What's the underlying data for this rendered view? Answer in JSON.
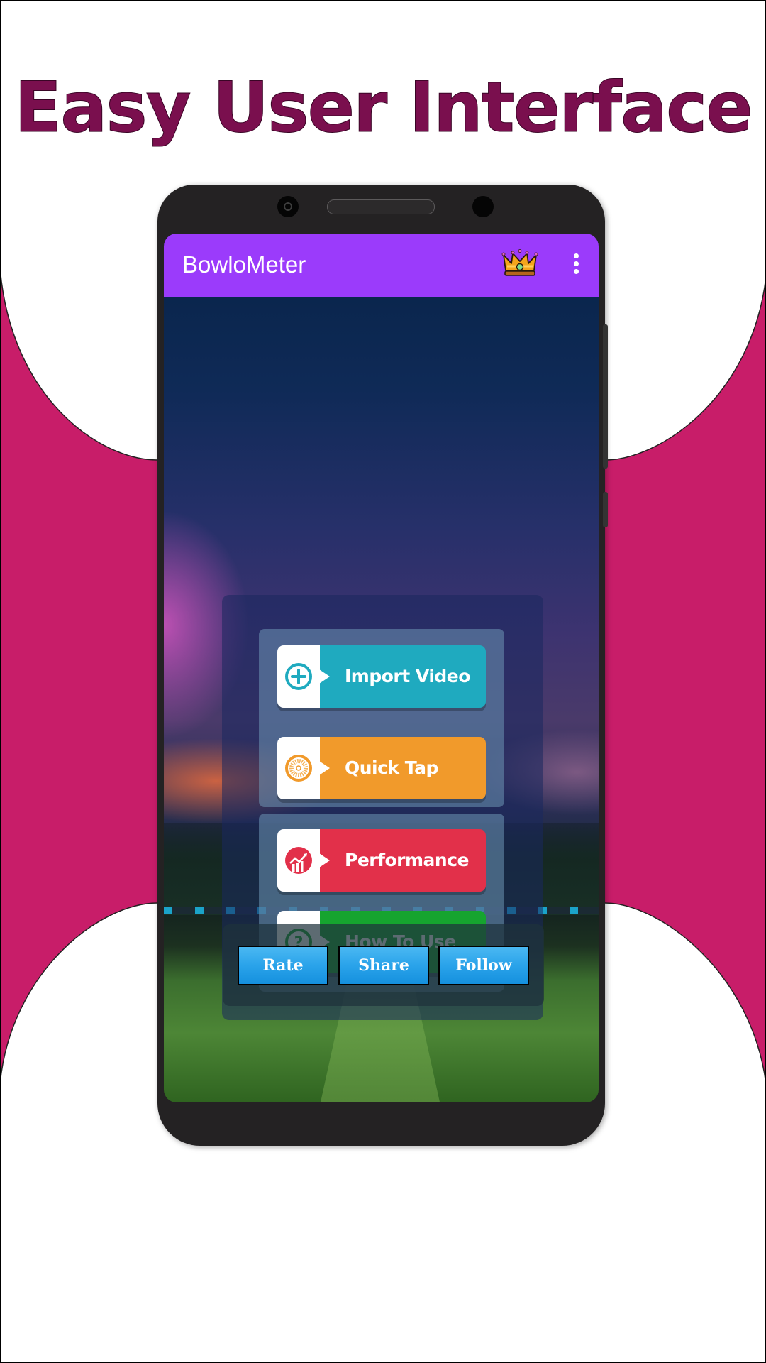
{
  "headline": "Easy User Interface",
  "colors": {
    "background": "#c81d69",
    "headline": "#7a0f4e",
    "appbar": "#9b3bfb",
    "import_video": "#1faabf",
    "quick_tap": "#f19a2b",
    "performance": "#e2304a",
    "how_to_use": "#16a42f",
    "action_button": "#2aa3ea"
  },
  "app": {
    "title": "BowloMeter",
    "premium_icon": "crown-icon",
    "menu_icon": "more-vert-icon"
  },
  "menu": [
    {
      "label": "Import Video",
      "icon": "add-circle-icon"
    },
    {
      "label": "Quick Tap",
      "icon": "tap-target-icon"
    },
    {
      "label": "Performance",
      "icon": "growth-chart-icon"
    },
    {
      "label": "How To Use",
      "icon": "help-circle-icon"
    }
  ],
  "actions": [
    {
      "label": "Rate"
    },
    {
      "label": "Share"
    },
    {
      "label": "Follow"
    }
  ]
}
